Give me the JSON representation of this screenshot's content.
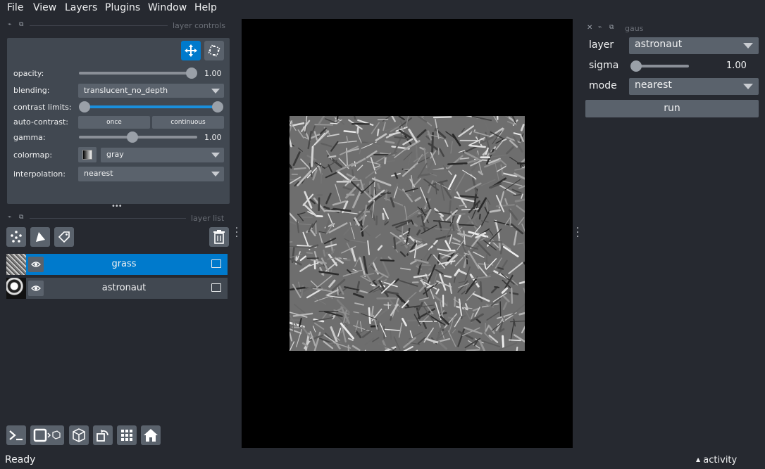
{
  "menu": {
    "file": "File",
    "view": "View",
    "layers": "Layers",
    "plugins": "Plugins",
    "window": "Window",
    "help": "Help"
  },
  "layer_controls": {
    "title": "layer controls",
    "opacity_label": "opacity:",
    "opacity_value": "1.00",
    "opacity_level": 1.0,
    "blending_label": "blending:",
    "blending_value": "translucent_no_depth",
    "contrast_label": "contrast limits:",
    "auto_contrast_label": "auto-contrast:",
    "once_label": "once",
    "continuous_label": "continuous",
    "gamma_label": "gamma:",
    "gamma_value": "1.00",
    "gamma_level": 0.45,
    "colormap_label": "colormap:",
    "colormap_value": "gray",
    "interpolation_label": "interpolation:",
    "interpolation_value": "nearest",
    "more_handle": "•••"
  },
  "layer_list": {
    "title": "layer list",
    "layers": [
      {
        "name": "grass",
        "selected": true
      },
      {
        "name": "astronaut",
        "selected": false
      }
    ]
  },
  "gaus_widget": {
    "title": "gaus",
    "layer_label": "layer",
    "layer_value": "astronaut",
    "sigma_label": "sigma",
    "sigma_value": "1.00",
    "sigma_level": 0.1,
    "mode_label": "mode",
    "mode_value": "nearest",
    "run_label": "run"
  },
  "status": {
    "text": "Ready",
    "activity_label": "activity"
  },
  "colors": {
    "background": "#262930",
    "panel": "#414851",
    "accent": "#007acc",
    "canvas": "#000000"
  }
}
